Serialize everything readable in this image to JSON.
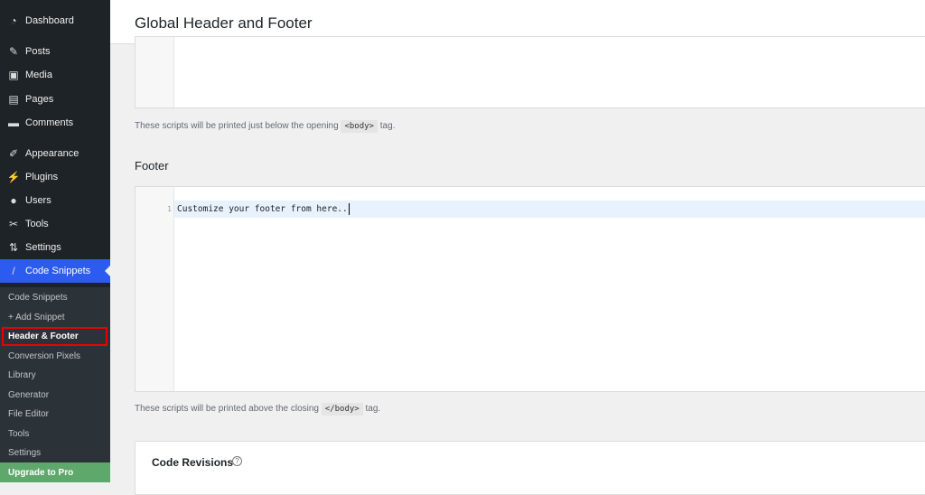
{
  "sidebar": {
    "menu": [
      {
        "label": "Dashboard",
        "icon": "dashboard-icon",
        "glyph": "◔"
      },
      {
        "label": "Posts",
        "icon": "pin-icon",
        "glyph": "✎"
      },
      {
        "label": "Media",
        "icon": "media-icon",
        "glyph": "▣"
      },
      {
        "label": "Pages",
        "icon": "pages-icon",
        "glyph": "▤"
      },
      {
        "label": "Comments",
        "icon": "comment-icon",
        "glyph": "▬"
      },
      {
        "label": "Appearance",
        "icon": "brush-icon",
        "glyph": "✐"
      },
      {
        "label": "Plugins",
        "icon": "plugin-icon",
        "glyph": "⚡"
      },
      {
        "label": "Users",
        "icon": "user-icon",
        "glyph": "●"
      },
      {
        "label": "Tools",
        "icon": "wrench-icon",
        "glyph": "✂"
      },
      {
        "label": "Settings",
        "icon": "settings-icon",
        "glyph": "⇅"
      },
      {
        "label": "Code Snippets",
        "icon": "code-snippets-icon",
        "glyph": "/"
      }
    ],
    "submenu": [
      "Code Snippets",
      "+ Add Snippet",
      "Header & Footer",
      "Conversion Pixels",
      "Library",
      "Generator",
      "File Editor",
      "Tools",
      "Settings",
      "Upgrade to Pro"
    ]
  },
  "header": {
    "title": "Global Header and Footer"
  },
  "body_note": {
    "before": "These scripts will be printed just below the opening",
    "code": "<body>",
    "after": "tag."
  },
  "footer": {
    "title": "Footer",
    "line_number": "1",
    "code": "Customize your footer from here.."
  },
  "footer_note": {
    "before": "These scripts will be printed above the closing",
    "code": "</body>",
    "after": "tag."
  },
  "revisions": {
    "title": "Code Revisions",
    "help_icon": "?"
  }
}
